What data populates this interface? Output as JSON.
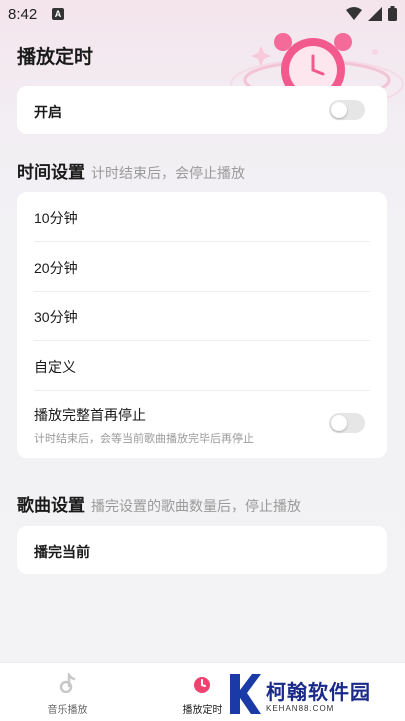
{
  "status_bar": {
    "time": "8:42",
    "app_icon": "A"
  },
  "header": {
    "title": "播放定时"
  },
  "enable_card": {
    "label": "开启",
    "enabled": false
  },
  "time_section": {
    "title": "时间设置",
    "subtitle": "计时结束后，会停止播放",
    "options": [
      "10分钟",
      "20分钟",
      "30分钟",
      "自定义"
    ],
    "finish_song": {
      "label": "播放完整首再停止",
      "description": "计时结束后，会等当前歌曲播放完毕后再停止",
      "enabled": false
    }
  },
  "song_section": {
    "title": "歌曲设置",
    "subtitle": "播完设置的歌曲数量后，停止播放",
    "option": "播完当前"
  },
  "tabbar": {
    "tabs": [
      {
        "label": "音乐播放",
        "icon": "music-note-icon"
      },
      {
        "label": "播放定时",
        "icon": "timer-icon"
      }
    ]
  },
  "watermark": {
    "text": "柯翰软件园",
    "sub": "KEHAN88.COM"
  },
  "colors": {
    "accent": "#f0426e",
    "toggle_off": "#e6e6e6"
  }
}
